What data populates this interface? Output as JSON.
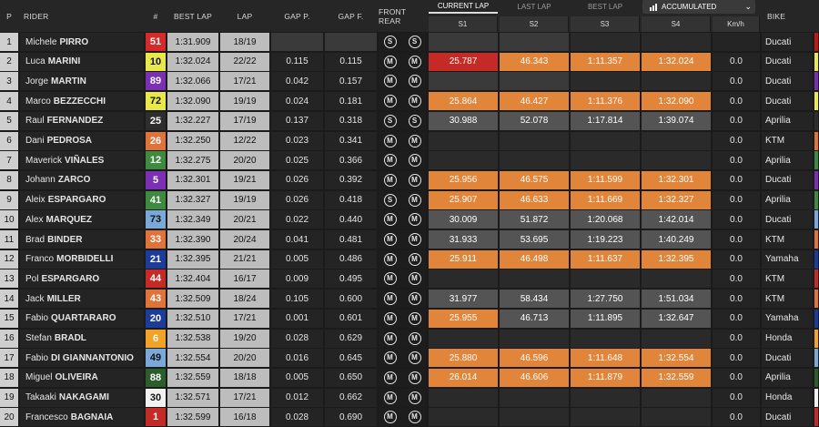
{
  "headers": {
    "p": "P",
    "rider": "RIDER",
    "num": "#",
    "best_lap": "BEST LAP",
    "lap": "LAP",
    "gap_p": "GAP P.",
    "gap_f": "GAP F.",
    "front_rear": "FRONT REAR",
    "tab_current": "CURRENT LAP",
    "tab_last": "LAST LAP",
    "tab_best": "BEST LAP",
    "mode": "ACCUMULATED",
    "bike": "BIKE",
    "s1": "S1",
    "s2": "S2",
    "s3": "S3",
    "s4": "S4",
    "kmh": "Km/h"
  },
  "colors": {
    "sector_best": "#e08539",
    "sector_overall_best": "#c42b26",
    "sector_normal": "#545454",
    "sector_empty": "#303030",
    "team_ducati": "#c41818",
    "team_aprilia": "#5a5a5a",
    "team_ktm": "#e08a1c",
    "team_yamaha": "#1c3c9c",
    "team_honda": "#d8d8d8"
  },
  "rows": [
    {
      "pos": "1",
      "first": "Michele",
      "last": "PIRRO",
      "num": "51",
      "num_bg": "#d62a2a",
      "num_fg": "#ffffff",
      "best": "1:31.909",
      "lap": "18/19",
      "gap_p": "",
      "gap_f": "",
      "front": "S",
      "rear": "S",
      "s": [
        "",
        "",
        "",
        ""
      ],
      "s_bg": [
        "#3a3a3a",
        "#3a3a3a",
        "#2a2a2a",
        "#2a2a2a"
      ],
      "kmh": "",
      "bike": "Ducati",
      "stripe": "#c41818"
    },
    {
      "pos": "2",
      "first": "Luca",
      "last": "MARINI",
      "num": "10",
      "num_bg": "#e8e84a",
      "num_fg": "#111111",
      "best": "1:32.024",
      "lap": "22/22",
      "gap_p": "0.115",
      "gap_f": "0.115",
      "front": "M",
      "rear": "M",
      "s": [
        "25.787",
        "46.343",
        "1:11.357",
        "1:32.024"
      ],
      "s_bg": [
        "#c42b26",
        "#e08539",
        "#e08539",
        "#e08539"
      ],
      "kmh": "0.0",
      "bike": "Ducati",
      "stripe": "#e8e84a"
    },
    {
      "pos": "3",
      "first": "Jorge",
      "last": "MARTIN",
      "num": "89",
      "num_bg": "#7a2fb4",
      "num_fg": "#ffffff",
      "best": "1:32.066",
      "lap": "17/21",
      "gap_p": "0.042",
      "gap_f": "0.157",
      "front": "M",
      "rear": "M",
      "s": [
        "",
        "",
        "",
        ""
      ],
      "s_bg": [
        "#3a3a3a",
        "#3a3a3a",
        "#2a2a2a",
        "#2a2a2a"
      ],
      "kmh": "0.0",
      "bike": "Ducati",
      "stripe": "#7a2fb4"
    },
    {
      "pos": "4",
      "first": "Marco",
      "last": "BEZZECCHI",
      "num": "72",
      "num_bg": "#e8e84a",
      "num_fg": "#111111",
      "best": "1:32.090",
      "lap": "19/19",
      "gap_p": "0.024",
      "gap_f": "0.181",
      "front": "M",
      "rear": "M",
      "s": [
        "25.864",
        "46.427",
        "1:11.376",
        "1:32.090"
      ],
      "s_bg": [
        "#e08539",
        "#e08539",
        "#e08539",
        "#e08539"
      ],
      "kmh": "0.0",
      "bike": "Ducati",
      "stripe": "#e8e84a"
    },
    {
      "pos": "5",
      "first": "Raul",
      "last": "FERNANDEZ",
      "num": "25",
      "num_bg": "#2e2e2e",
      "num_fg": "#ffffff",
      "best": "1:32.227",
      "lap": "17/19",
      "gap_p": "0.137",
      "gap_f": "0.318",
      "front": "S",
      "rear": "S",
      "s": [
        "30.988",
        "52.078",
        "1:17.814",
        "1:39.074"
      ],
      "s_bg": [
        "#545454",
        "#545454",
        "#545454",
        "#545454"
      ],
      "kmh": "0.0",
      "bike": "Aprilia",
      "stripe": "#2e2e2e"
    },
    {
      "pos": "6",
      "first": "Dani",
      "last": "PEDROSA",
      "num": "26",
      "num_bg": "#e0733a",
      "num_fg": "#ffffff",
      "best": "1:32.250",
      "lap": "12/22",
      "gap_p": "0.023",
      "gap_f": "0.341",
      "front": "M",
      "rear": "M",
      "s": [
        "",
        "",
        "",
        ""
      ],
      "s_bg": [
        "#2a2a2a",
        "#2a2a2a",
        "#2a2a2a",
        "#2a2a2a"
      ],
      "kmh": "0.0",
      "bike": "KTM",
      "stripe": "#e0733a"
    },
    {
      "pos": "7",
      "first": "Maverick",
      "last": "VIÑALES",
      "num": "12",
      "num_bg": "#3e8a3e",
      "num_fg": "#ffffff",
      "best": "1:32.275",
      "lap": "20/20",
      "gap_p": "0.025",
      "gap_f": "0.366",
      "front": "M",
      "rear": "M",
      "s": [
        "",
        "",
        "",
        ""
      ],
      "s_bg": [
        "#2a2a2a",
        "#2a2a2a",
        "#2a2a2a",
        "#2a2a2a"
      ],
      "kmh": "0.0",
      "bike": "Aprilia",
      "stripe": "#3e8a3e"
    },
    {
      "pos": "8",
      "first": "Johann",
      "last": "ZARCO",
      "num": "5",
      "num_bg": "#7a2fb4",
      "num_fg": "#ffffff",
      "best": "1:32.301",
      "lap": "19/21",
      "gap_p": "0.026",
      "gap_f": "0.392",
      "front": "M",
      "rear": "M",
      "s": [
        "25.956",
        "46.575",
        "1:11.599",
        "1:32.301"
      ],
      "s_bg": [
        "#e08539",
        "#e08539",
        "#e08539",
        "#e08539"
      ],
      "kmh": "0.0",
      "bike": "Ducati",
      "stripe": "#7a2fb4"
    },
    {
      "pos": "9",
      "first": "Aleix",
      "last": "ESPARGARO",
      "num": "41",
      "num_bg": "#3e8a3e",
      "num_fg": "#ffffff",
      "best": "1:32.327",
      "lap": "19/19",
      "gap_p": "0.026",
      "gap_f": "0.418",
      "front": "S",
      "rear": "M",
      "s": [
        "25.907",
        "46.633",
        "1:11.669",
        "1:32.327"
      ],
      "s_bg": [
        "#e08539",
        "#e08539",
        "#e08539",
        "#e08539"
      ],
      "kmh": "0.0",
      "bike": "Aprilia",
      "stripe": "#3e8a3e"
    },
    {
      "pos": "10",
      "first": "Alex",
      "last": "MARQUEZ",
      "num": "73",
      "num_bg": "#7aa8d8",
      "num_fg": "#111111",
      "best": "1:32.349",
      "lap": "20/21",
      "gap_p": "0.022",
      "gap_f": "0.440",
      "front": "M",
      "rear": "M",
      "s": [
        "30.009",
        "51.872",
        "1:20.068",
        "1:42.014"
      ],
      "s_bg": [
        "#545454",
        "#545454",
        "#545454",
        "#545454"
      ],
      "kmh": "0.0",
      "bike": "Ducati",
      "stripe": "#7aa8d8"
    },
    {
      "pos": "11",
      "first": "Brad",
      "last": "BINDER",
      "num": "33",
      "num_bg": "#e0733a",
      "num_fg": "#ffffff",
      "best": "1:32.390",
      "lap": "20/24",
      "gap_p": "0.041",
      "gap_f": "0.481",
      "front": "M",
      "rear": "M",
      "s": [
        "31.933",
        "53.695",
        "1:19.223",
        "1:40.249"
      ],
      "s_bg": [
        "#545454",
        "#545454",
        "#545454",
        "#545454"
      ],
      "kmh": "0.0",
      "bike": "KTM",
      "stripe": "#e0733a"
    },
    {
      "pos": "12",
      "first": "Franco",
      "last": "MORBIDELLI",
      "num": "21",
      "num_bg": "#1c3c9c",
      "num_fg": "#ffffff",
      "best": "1:32.395",
      "lap": "21/21",
      "gap_p": "0.005",
      "gap_f": "0.486",
      "front": "M",
      "rear": "M",
      "s": [
        "25.911",
        "46.498",
        "1:11.637",
        "1:32.395"
      ],
      "s_bg": [
        "#e08539",
        "#e08539",
        "#e08539",
        "#e08539"
      ],
      "kmh": "0.0",
      "bike": "Yamaha",
      "stripe": "#1c3c9c"
    },
    {
      "pos": "13",
      "first": "Pol",
      "last": "ESPARGARO",
      "num": "44",
      "num_bg": "#c42b26",
      "num_fg": "#ffffff",
      "best": "1:32.404",
      "lap": "16/17",
      "gap_p": "0.009",
      "gap_f": "0.495",
      "front": "M",
      "rear": "M",
      "s": [
        "",
        "",
        "",
        ""
      ],
      "s_bg": [
        "#2a2a2a",
        "#2a2a2a",
        "#2a2a2a",
        "#2a2a2a"
      ],
      "kmh": "0.0",
      "bike": "KTM",
      "stripe": "#c42b26"
    },
    {
      "pos": "14",
      "first": "Jack",
      "last": "MILLER",
      "num": "43",
      "num_bg": "#e0733a",
      "num_fg": "#ffffff",
      "best": "1:32.509",
      "lap": "18/24",
      "gap_p": "0.105",
      "gap_f": "0.600",
      "front": "M",
      "rear": "M",
      "s": [
        "31.977",
        "58.434",
        "1:27.750",
        "1:51.034"
      ],
      "s_bg": [
        "#545454",
        "#545454",
        "#545454",
        "#545454"
      ],
      "kmh": "0.0",
      "bike": "KTM",
      "stripe": "#e0733a"
    },
    {
      "pos": "15",
      "first": "Fabio",
      "last": "QUARTARARO",
      "num": "20",
      "num_bg": "#1c3c9c",
      "num_fg": "#ffffff",
      "best": "1:32.510",
      "lap": "17/21",
      "gap_p": "0.001",
      "gap_f": "0.601",
      "front": "M",
      "rear": "M",
      "s": [
        "25.955",
        "46.713",
        "1:11.895",
        "1:32.647"
      ],
      "s_bg": [
        "#e08539",
        "#545454",
        "#545454",
        "#545454"
      ],
      "kmh": "0.0",
      "bike": "Yamaha",
      "stripe": "#1c3c9c"
    },
    {
      "pos": "16",
      "first": "Stefan",
      "last": "BRADL",
      "num": "6",
      "num_bg": "#f2a227",
      "num_fg": "#ffffff",
      "best": "1:32.538",
      "lap": "19/20",
      "gap_p": "0.028",
      "gap_f": "0.629",
      "front": "M",
      "rear": "M",
      "s": [
        "",
        "",
        "",
        ""
      ],
      "s_bg": [
        "#2a2a2a",
        "#2a2a2a",
        "#2a2a2a",
        "#2a2a2a"
      ],
      "kmh": "0.0",
      "bike": "Honda",
      "stripe": "#f2a227"
    },
    {
      "pos": "17",
      "first": "Fabio",
      "last": "DI GIANNANTONIO",
      "num": "49",
      "num_bg": "#7aa8d8",
      "num_fg": "#111111",
      "best": "1:32.554",
      "lap": "20/20",
      "gap_p": "0.016",
      "gap_f": "0.645",
      "front": "M",
      "rear": "M",
      "s": [
        "25.880",
        "46.596",
        "1:11.648",
        "1:32.554"
      ],
      "s_bg": [
        "#e08539",
        "#e08539",
        "#e08539",
        "#e08539"
      ],
      "kmh": "0.0",
      "bike": "Ducati",
      "stripe": "#7aa8d8"
    },
    {
      "pos": "18",
      "first": "Miguel",
      "last": "OLIVEIRA",
      "num": "88",
      "num_bg": "#2b5e2b",
      "num_fg": "#ffffff",
      "best": "1:32.559",
      "lap": "18/18",
      "gap_p": "0.005",
      "gap_f": "0.650",
      "front": "M",
      "rear": "M",
      "s": [
        "26.014",
        "46.606",
        "1:11.879",
        "1:32.559"
      ],
      "s_bg": [
        "#e08539",
        "#e08539",
        "#e08539",
        "#e08539"
      ],
      "kmh": "0.0",
      "bike": "Aprilia",
      "stripe": "#2b5e2b"
    },
    {
      "pos": "19",
      "first": "Takaaki",
      "last": "NAKAGAMI",
      "num": "30",
      "num_bg": "#f2f2f2",
      "num_fg": "#111111",
      "best": "1:32.571",
      "lap": "17/21",
      "gap_p": "0.012",
      "gap_f": "0.662",
      "front": "M",
      "rear": "M",
      "s": [
        "",
        "",
        "",
        ""
      ],
      "s_bg": [
        "#2a2a2a",
        "#2a2a2a",
        "#2a2a2a",
        "#2a2a2a"
      ],
      "kmh": "0.0",
      "bike": "Honda",
      "stripe": "#f2f2f2"
    },
    {
      "pos": "20",
      "first": "Francesco",
      "last": "BAGNAIA",
      "num": "1",
      "num_bg": "#c42b26",
      "num_fg": "#ffffff",
      "best": "1:32.599",
      "lap": "16/18",
      "gap_p": "0.028",
      "gap_f": "0.690",
      "front": "M",
      "rear": "M",
      "s": [
        "",
        "",
        "",
        ""
      ],
      "s_bg": [
        "#2a2a2a",
        "#2a2a2a",
        "#2a2a2a",
        "#2a2a2a"
      ],
      "kmh": "0.0",
      "bike": "Ducati",
      "stripe": "#c42b26"
    }
  ]
}
